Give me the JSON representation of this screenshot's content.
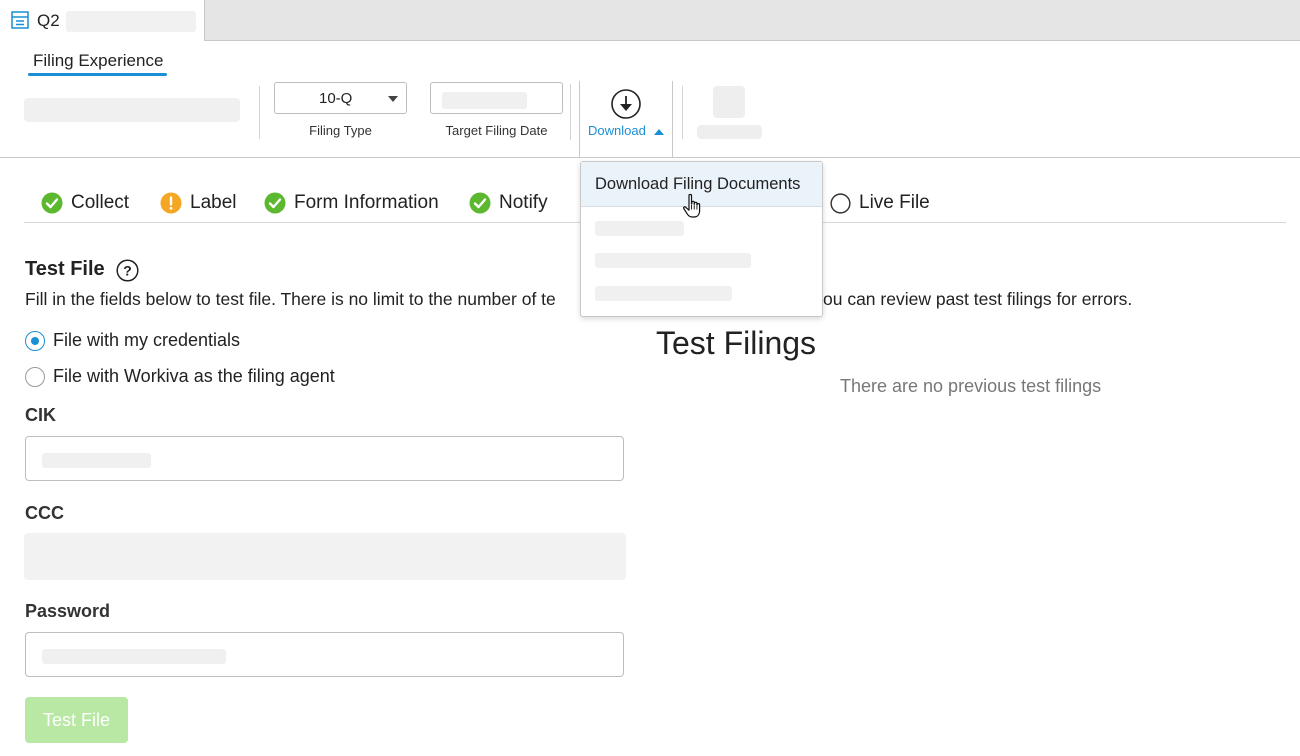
{
  "tab": {
    "title": "Q2",
    "icon": "document-list-icon"
  },
  "subnav": {
    "title": "Filing Experience"
  },
  "toolbar": {
    "filing_type_value": "10-Q",
    "filing_type_label": "Filing Type",
    "target_date_label": "Target Filing Date",
    "download_label": "Download"
  },
  "steps": [
    {
      "label": "Collect",
      "status": "complete"
    },
    {
      "label": "Label",
      "status": "warning"
    },
    {
      "label": "Form Information",
      "status": "complete"
    },
    {
      "label": "Notify",
      "status": "complete"
    },
    {
      "label": "Live File",
      "status": "pending"
    }
  ],
  "test_file": {
    "title": "Test File",
    "description_left": "Fill in the fields below to test file. There is no limit to the number of te",
    "description_right": "ou can review past test filings for errors.",
    "radio_credentials": "File with my credentials",
    "radio_agent": "File with Workiva as the filing agent",
    "cik_label": "CIK",
    "ccc_label": "CCC",
    "password_label": "Password",
    "button_label": "Test File"
  },
  "test_filings": {
    "title": "Test Filings",
    "empty_text": "There are no previous test filings"
  },
  "download_menu": {
    "items": [
      "Download Filing Documents"
    ]
  },
  "colors": {
    "accent": "#1a8fd6",
    "success": "#5cb82f",
    "warning": "#f5a623",
    "button_disabled": "#b9e7a4"
  }
}
